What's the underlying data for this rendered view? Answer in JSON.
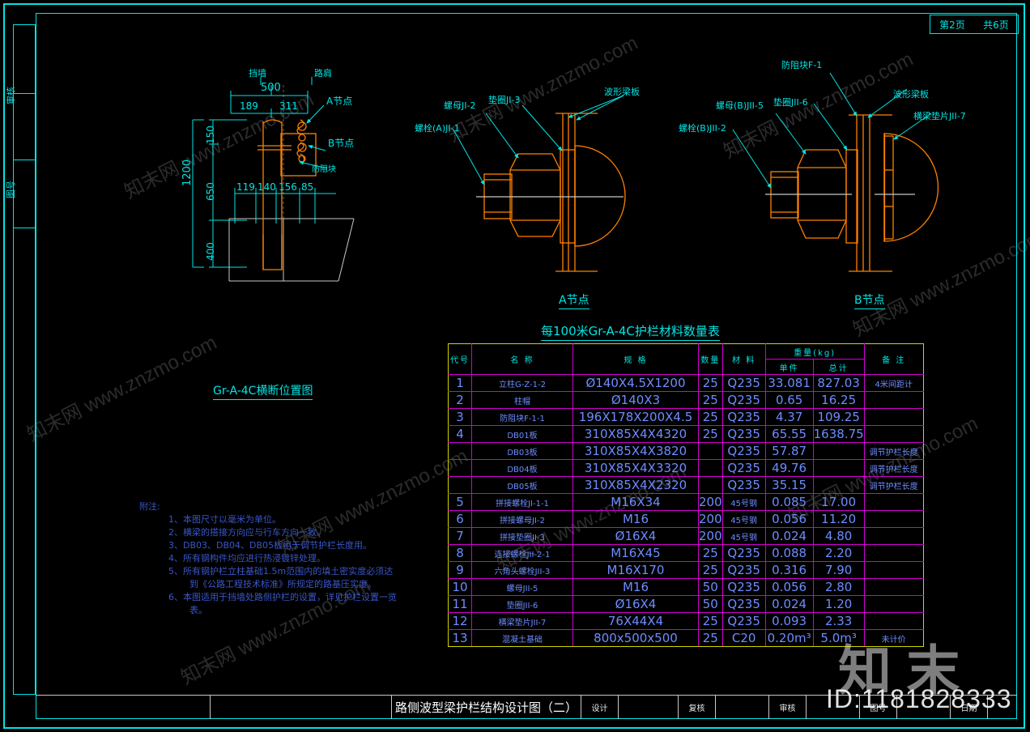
{
  "sheet": {
    "page_label": "第2页",
    "total_label": "共6页",
    "side_labels": [
      "审核",
      "图号"
    ]
  },
  "section_view": {
    "caption": "Gr-A-4C横断位置图",
    "labels": {
      "left_top": "挡墙",
      "right_top": "路肩",
      "node_a": "A节点",
      "node_b": "B节点",
      "block": "防阻块"
    },
    "dimensions": {
      "overall_width": "500",
      "left_offset": "189",
      "right_offset": "311",
      "height_total": "1200",
      "h_top": "150",
      "h_mid": "650",
      "h_bottom": "400",
      "base_chain": [
        "119",
        "140",
        "156",
        "85"
      ]
    }
  },
  "node_a": {
    "caption": "A节点",
    "labels": [
      "螺栓(A)JI-1",
      "螺母JI-2",
      "垫圈JI-3",
      "波形梁板"
    ]
  },
  "node_b": {
    "caption": "B节点",
    "labels": [
      "螺栓(B)JII-2",
      "螺母(B)JII-5",
      "垫圈JII-6",
      "防阻块F-1",
      "波形梁板",
      "横梁垫片JII-7"
    ]
  },
  "materials_table": {
    "title": "每100米Gr-A-4C护栏材料数量表",
    "headers": {
      "code": "代号",
      "name": "名  称",
      "spec": "规  格",
      "qty": "数量",
      "material": "材  料",
      "weight_group": "重量(kg)",
      "weight_unit": "单件",
      "weight_total": "总计",
      "remark": "备  注"
    },
    "rows": [
      {
        "code": "1",
        "name": "立柱G-Z-1-2",
        "spec": "Ø140X4.5X1200",
        "qty": "25",
        "material": "Q235",
        "unit": "33.081",
        "total": "827.03",
        "remark": "4米间距计"
      },
      {
        "code": "2",
        "name": "柱帽",
        "spec": "Ø140X3",
        "qty": "25",
        "material": "Q235",
        "unit": "0.65",
        "total": "16.25",
        "remark": ""
      },
      {
        "code": "3",
        "name": "防阻块F-1-1",
        "spec": "196X178X200X4.5",
        "qty": "25",
        "material": "Q235",
        "unit": "4.37",
        "total": "109.25",
        "remark": ""
      },
      {
        "code": "4",
        "name": "DB01板",
        "spec": "310X85X4X4320",
        "qty": "25",
        "material": "Q235",
        "unit": "65.55",
        "total": "1638.75",
        "remark": ""
      },
      {
        "code": "",
        "name": "DB03板",
        "spec": "310X85X4X3820",
        "qty": "",
        "material": "Q235",
        "unit": "57.87",
        "total": "",
        "remark": "调节护栏长度"
      },
      {
        "code": "",
        "name": "DB04板",
        "spec": "310X85X4X3320",
        "qty": "",
        "material": "Q235",
        "unit": "49.76",
        "total": "",
        "remark": "调节护栏长度"
      },
      {
        "code": "",
        "name": "DB05板",
        "spec": "310X85X4X2320",
        "qty": "",
        "material": "Q235",
        "unit": "35.15",
        "total": "",
        "remark": "调节护栏长度"
      },
      {
        "code": "5",
        "name": "拼接螺栓JI-1-1",
        "spec": "M16X34",
        "qty": "200",
        "material": "45号钢",
        "unit": "0.085",
        "total": "17.00",
        "remark": ""
      },
      {
        "code": "6",
        "name": "拼接螺母JI-2",
        "spec": "M16",
        "qty": "200",
        "material": "45号钢",
        "unit": "0.056",
        "total": "11.20",
        "remark": ""
      },
      {
        "code": "7",
        "name": "拼接垫圈JI-3",
        "spec": "Ø16X4",
        "qty": "200",
        "material": "45号钢",
        "unit": "0.024",
        "total": "4.80",
        "remark": ""
      },
      {
        "code": "8",
        "name": "连接螺栓JII-2-1",
        "spec": "M16X45",
        "qty": "25",
        "material": "Q235",
        "unit": "0.088",
        "total": "2.20",
        "remark": ""
      },
      {
        "code": "9",
        "name": "六角头螺栓JII-3",
        "spec": "M16X170",
        "qty": "25",
        "material": "Q235",
        "unit": "0.316",
        "total": "7.90",
        "remark": ""
      },
      {
        "code": "10",
        "name": "螺母JII-5",
        "spec": "M16",
        "qty": "50",
        "material": "Q235",
        "unit": "0.056",
        "total": "2.80",
        "remark": ""
      },
      {
        "code": "11",
        "name": "垫圈JII-6",
        "spec": "Ø16X4",
        "qty": "50",
        "material": "Q235",
        "unit": "0.024",
        "total": "1.20",
        "remark": ""
      },
      {
        "code": "12",
        "name": "横梁垫片JII-7",
        "spec": "76X44X4",
        "qty": "25",
        "material": "Q235",
        "unit": "0.093",
        "total": "2.33",
        "remark": ""
      },
      {
        "code": "13",
        "name": "混凝土基础",
        "spec": "800x500x500",
        "qty": "25",
        "material": "C20",
        "unit": "0.20m³",
        "total": "5.0m³",
        "remark": "未计价"
      }
    ]
  },
  "notes": {
    "header": "附注:",
    "items": [
      "1、本图尺寸以毫米为单位。",
      "2、横梁的搭接方向应与行车方向一致。",
      "3、DB03、DB04、DB05板用于调节护栏长度用。",
      "4、所有钢构件均应进行热浸镀锌处理。",
      "5、所有钢护栏立柱基础1.5m范围内的填土密实度必须达",
      "到《公路工程技术标准》所规定的路基压实度。",
      "6、本图适用于挡墙处路侧护栏的设置，详见护栏设置一览",
      "表。"
    ]
  },
  "title_block": {
    "drawing_title": "路侧波型梁护栏结构设计图（二）",
    "fields": [
      "设计",
      "复核",
      "审核",
      "图号",
      "日期"
    ]
  },
  "watermarks": {
    "site": "知末网 www.znzmo.com",
    "brand": "知 末",
    "id": "ID:1181828333"
  },
  "colors": {
    "cyan": "#00e5e5",
    "orange": "#ff8000",
    "blue": "#6e8cff",
    "magenta": "#d000d0",
    "yellow": "#d4d400",
    "background": "#000000"
  }
}
